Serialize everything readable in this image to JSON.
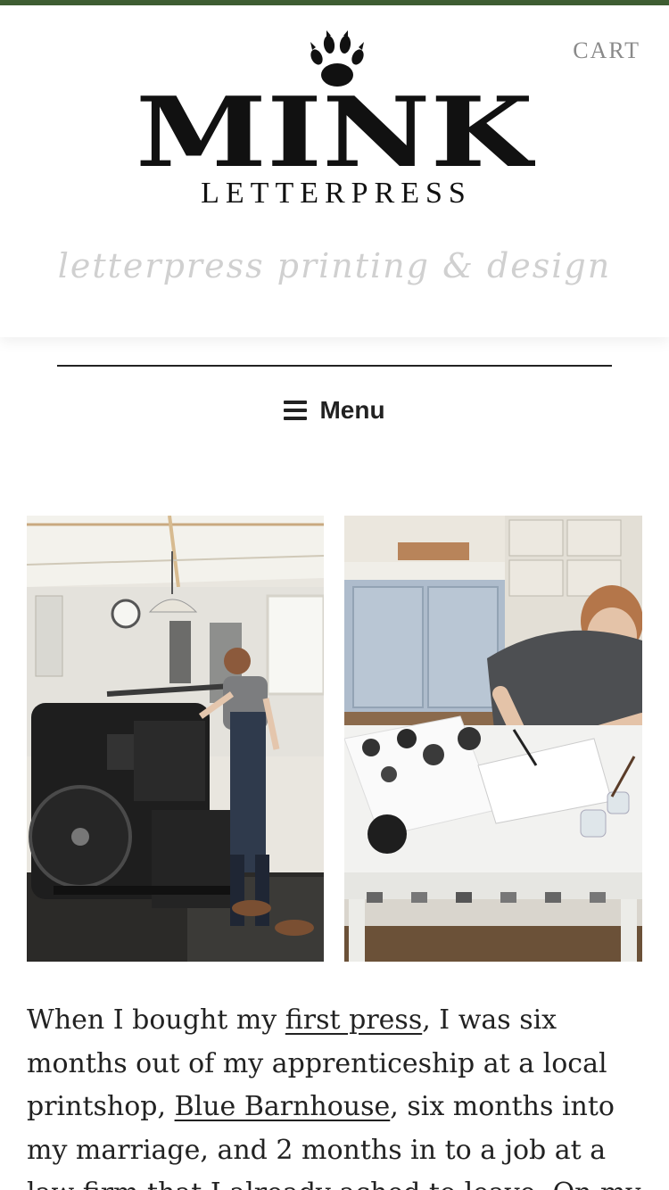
{
  "header": {
    "cart_label": "CART",
    "logo_main": "MINK",
    "logo_sub": "LETTERPRESS",
    "tagline": "letterpress printing & design"
  },
  "nav": {
    "menu_label": "Menu"
  },
  "photos": [
    {
      "icon": "letterpress-workshop-photo"
    },
    {
      "icon": "designer-sketching-photo"
    }
  ],
  "intro": {
    "text_1": "When I bought my ",
    "link_1": "first press",
    "text_2": ", I was six months out of my apprenticeship at a local printshop, ",
    "link_2": "Blue Barnhouse",
    "text_3": ", six months into my marriage, and 2 months in to a job at a law firm that I already ached to leave. On my"
  },
  "colors": {
    "accent_stripe": "#3f5e33",
    "cart": "#8a8a8a",
    "tagline": "#d0d0d0",
    "text": "#222222"
  }
}
